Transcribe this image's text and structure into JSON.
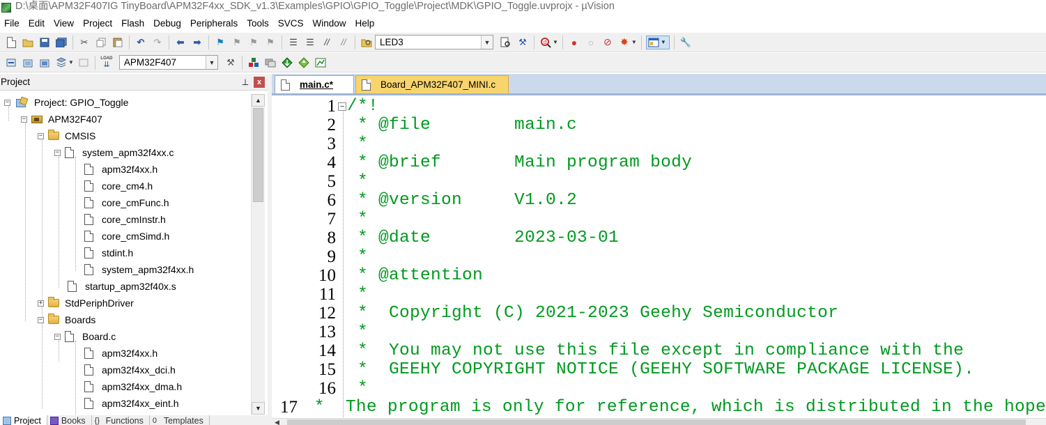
{
  "window": {
    "title": "D:\\桌面\\APM32F407IG TinyBoard\\APM32F4xx_SDK_v1.3\\Examples\\GPIO\\GPIO_Toggle\\Project\\MDK\\GPIO_Toggle.uvprojx - µVision"
  },
  "menu": [
    "File",
    "Edit",
    "View",
    "Project",
    "Flash",
    "Debug",
    "Peripherals",
    "Tools",
    "SVCS",
    "Window",
    "Help"
  ],
  "toolbar": {
    "find_value": "LED3",
    "target_value": "APM32F407",
    "load_label": "LOAD"
  },
  "project_panel": {
    "title": "Project",
    "pin_glyph": "📌",
    "close_glyph": "x",
    "tree": [
      {
        "label": "Project: GPIO_Toggle",
        "level": 0,
        "kind": "project",
        "expander": "−"
      },
      {
        "label": "APM32F407",
        "level": 1,
        "kind": "target",
        "expander": "−"
      },
      {
        "label": "CMSIS",
        "level": 2,
        "kind": "folder",
        "expander": "−"
      },
      {
        "label": "system_apm32f4xx.c",
        "level": 3,
        "kind": "file",
        "expander": "−"
      },
      {
        "label": "apm32f4xx.h",
        "level": 4,
        "kind": "file",
        "expander": ""
      },
      {
        "label": "core_cm4.h",
        "level": 4,
        "kind": "file",
        "expander": ""
      },
      {
        "label": "core_cmFunc.h",
        "level": 4,
        "kind": "file",
        "expander": ""
      },
      {
        "label": "core_cmInstr.h",
        "level": 4,
        "kind": "file",
        "expander": ""
      },
      {
        "label": "core_cmSimd.h",
        "level": 4,
        "kind": "file",
        "expander": ""
      },
      {
        "label": "stdint.h",
        "level": 4,
        "kind": "file",
        "expander": ""
      },
      {
        "label": "system_apm32f4xx.h",
        "level": 4,
        "kind": "file",
        "expander": ""
      },
      {
        "label": "startup_apm32f40x.s",
        "level": 3,
        "kind": "file",
        "expander": ""
      },
      {
        "label": "StdPeriphDriver",
        "level": 2,
        "kind": "folder",
        "expander": "+"
      },
      {
        "label": "Boards",
        "level": 2,
        "kind": "folder",
        "expander": "−"
      },
      {
        "label": "Board.c",
        "level": 3,
        "kind": "file",
        "expander": "−"
      },
      {
        "label": "apm32f4xx.h",
        "level": 4,
        "kind": "file",
        "expander": ""
      },
      {
        "label": "apm32f4xx_dci.h",
        "level": 4,
        "kind": "file",
        "expander": ""
      },
      {
        "label": "apm32f4xx_dma.h",
        "level": 4,
        "kind": "file",
        "expander": ""
      },
      {
        "label": "apm32f4xx_eint.h",
        "level": 4,
        "kind": "file",
        "expander": ""
      }
    ],
    "bottom_tabs": [
      "Project",
      "Books",
      "Functions",
      "Templates"
    ]
  },
  "editor": {
    "tabs": [
      {
        "label": "main.c*",
        "active": true
      },
      {
        "label": "Board_APM32F407_MINI.c",
        "active": false
      }
    ],
    "lines": [
      {
        "n": "1",
        "text": "/*!",
        "fold": "−"
      },
      {
        "n": "2",
        "text": " * @file        main.c",
        "fold": ""
      },
      {
        "n": "3",
        "text": " *",
        "fold": ""
      },
      {
        "n": "4",
        "text": " * @brief       Main program body",
        "fold": ""
      },
      {
        "n": "5",
        "text": " *",
        "fold": ""
      },
      {
        "n": "6",
        "text": " * @version     V1.0.2",
        "fold": ""
      },
      {
        "n": "7",
        "text": " *",
        "fold": ""
      },
      {
        "n": "8",
        "text": " * @date        2023-03-01",
        "fold": ""
      },
      {
        "n": "9",
        "text": " *",
        "fold": ""
      },
      {
        "n": "10",
        "text": " * @attention",
        "fold": ""
      },
      {
        "n": "11",
        "text": " *",
        "fold": ""
      },
      {
        "n": "12",
        "text": " *  Copyright (C) 2021-2023 Geehy Semiconductor",
        "fold": ""
      },
      {
        "n": "13",
        "text": " *",
        "fold": ""
      },
      {
        "n": "14",
        "text": " *  You may not use this file except in compliance with the",
        "fold": ""
      },
      {
        "n": "15",
        "text": " *  GEEHY COPYRIGHT NOTICE (GEEHY SOFTWARE PACKAGE LICENSE).",
        "fold": ""
      },
      {
        "n": "16",
        "text": " *",
        "fold": ""
      },
      {
        "n": "17",
        "text": " *  The program is only for reference, which is distributed in the hope",
        "fold": ""
      }
    ]
  },
  "colors": {
    "comment_green": "#009a1f",
    "tab_inactive": "#f7d46d",
    "tabstrip": "#cbd9ec"
  }
}
